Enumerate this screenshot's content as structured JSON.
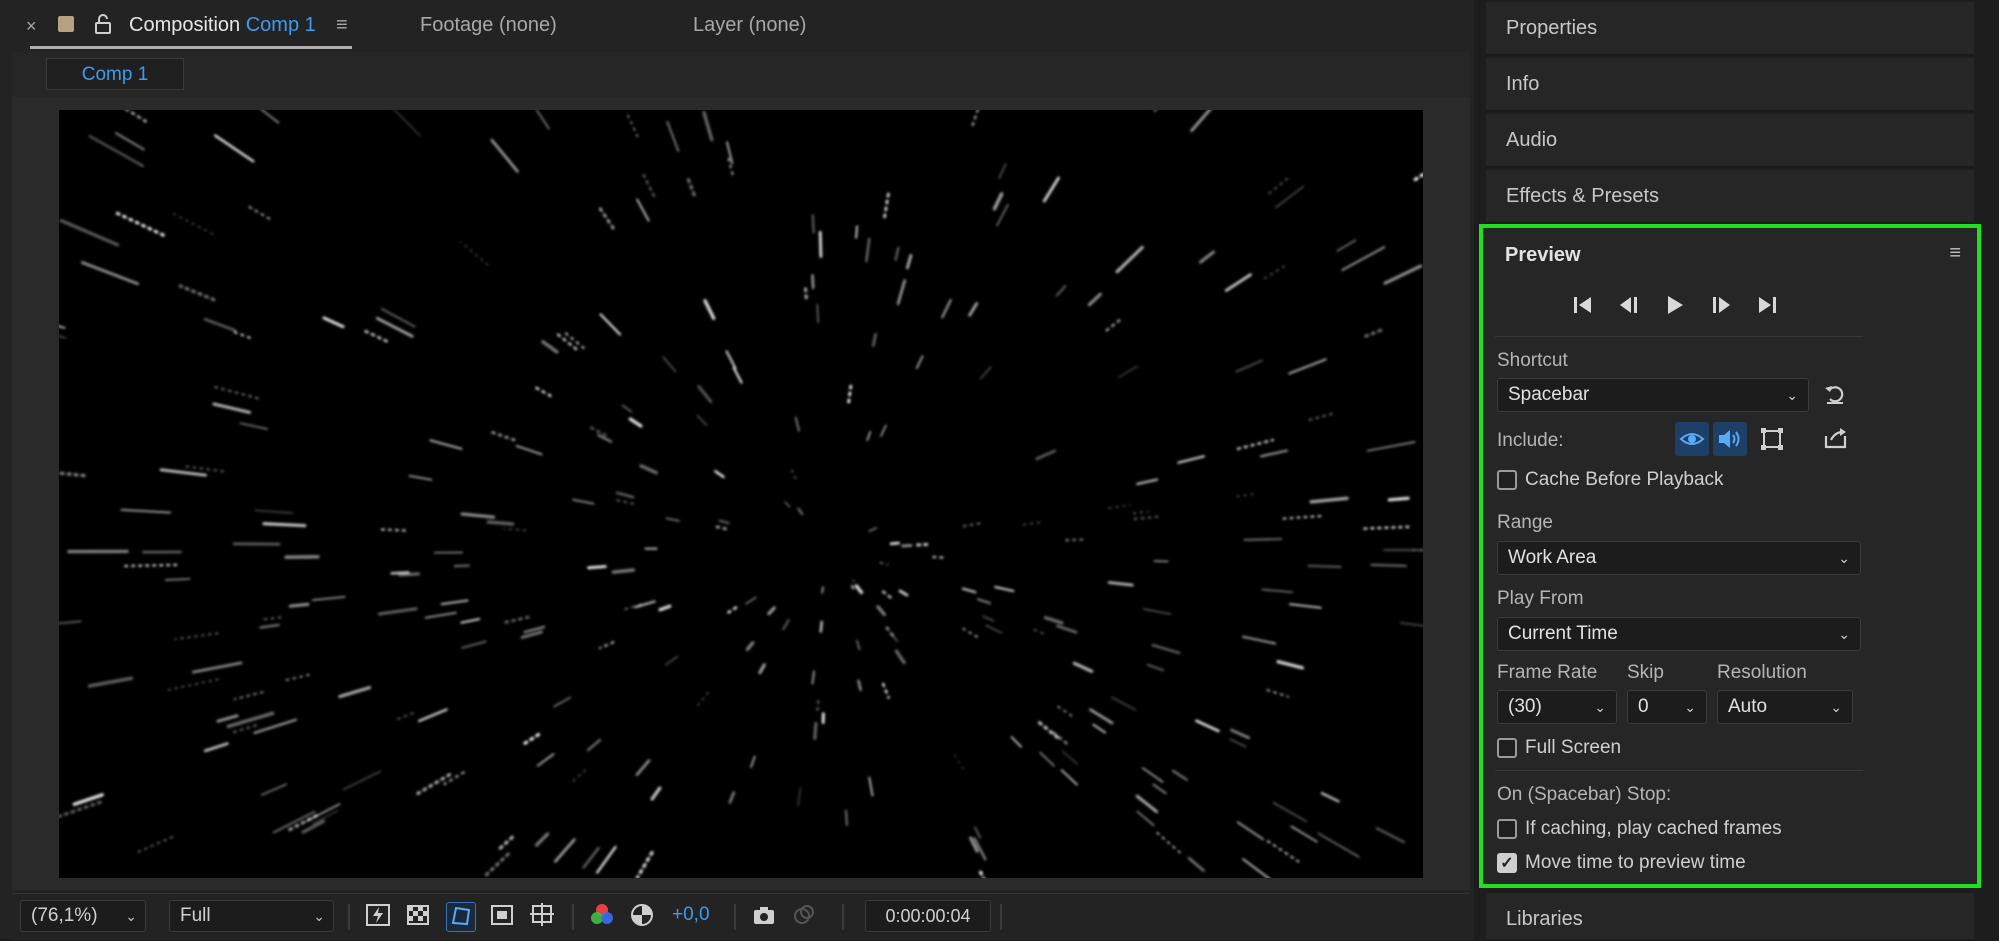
{
  "composition_panel": {
    "close_glyph": "×",
    "tab_label": "Composition",
    "tab_comp": "Comp 1",
    "menu_glyph": "≡",
    "footage_tab": "Footage (none)",
    "layer_tab": "Layer (none)",
    "breadcrumb": "Comp 1"
  },
  "viewer_controls": {
    "zoom": "(76,1%)",
    "resolution": "Full",
    "exposure": "+0,0",
    "timecode": "0:00:00:04"
  },
  "right_panels": {
    "properties": "Properties",
    "info": "Info",
    "audio": "Audio",
    "effects": "Effects & Presets",
    "libraries": "Libraries"
  },
  "preview": {
    "title": "Preview",
    "menu_glyph": "≡",
    "transport": {
      "first": "⏮",
      "prev": "◀|",
      "play": "▶",
      "next": "|▶",
      "last": "⏭"
    },
    "shortcut_label": "Shortcut",
    "shortcut_value": "Spacebar",
    "include_label": "Include:",
    "cache_before_playback": "Cache Before Playback",
    "cache_checked": false,
    "range_label": "Range",
    "range_value": "Work Area",
    "play_from_label": "Play From",
    "play_from_value": "Current Time",
    "frame_rate_label": "Frame Rate",
    "frame_rate_value": "(30)",
    "skip_label": "Skip",
    "skip_value": "0",
    "resolution_label": "Resolution",
    "resolution_value": "Auto",
    "full_screen": "Full Screen",
    "full_screen_checked": false,
    "on_stop_label": "On (Spacebar) Stop:",
    "if_caching": "If caching, play cached frames",
    "if_caching_checked": false,
    "move_time": "Move time to preview time",
    "move_time_checked": true
  },
  "colors": {
    "accent_blue": "#3b9bf0",
    "highlight_green": "#21e021",
    "panel_bg": "#262626"
  }
}
